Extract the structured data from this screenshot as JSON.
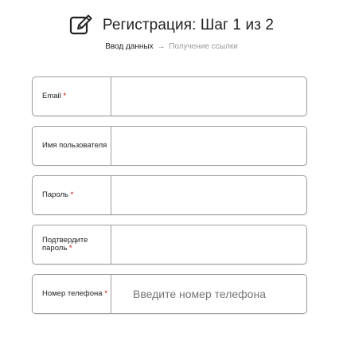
{
  "header": {
    "title": "Регистрация: Шаг 1 из 2",
    "icon": "edit-icon"
  },
  "steps": {
    "current": "Ввод данных",
    "arrow": "→",
    "next": "Получение ссылки"
  },
  "form": {
    "fields": [
      {
        "label": "Email",
        "required_mark": " *",
        "value": "",
        "placeholder": ""
      },
      {
        "label": "Имя пользователя",
        "required_mark": "",
        "value": "",
        "placeholder": ""
      },
      {
        "label": "Пароль",
        "required_mark": " *",
        "value": "",
        "placeholder": ""
      },
      {
        "label": "Подтвердите пароль",
        "required_mark": " *",
        "value": "",
        "placeholder": ""
      },
      {
        "label": "Номер телефона",
        "required_mark": " *",
        "value": "",
        "placeholder": "Введите номер телефона"
      }
    ]
  },
  "colors": {
    "border": "#9e9e9e",
    "inactive_step": "#9a9a9a",
    "text": "#222222"
  }
}
